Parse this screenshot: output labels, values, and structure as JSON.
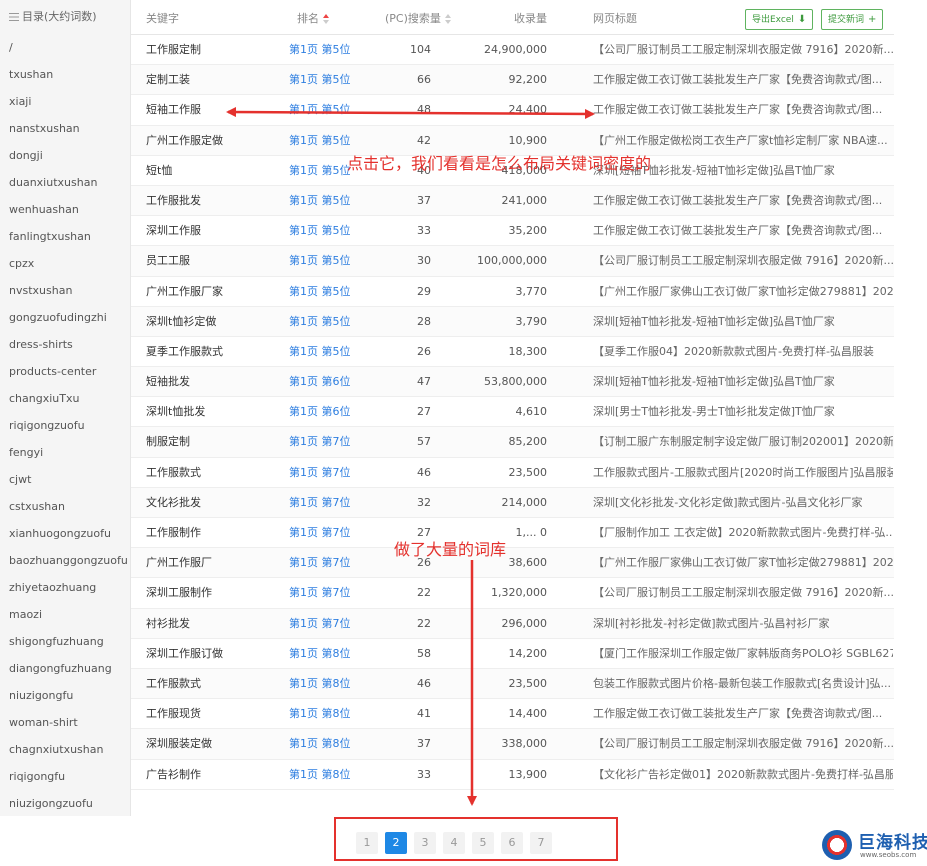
{
  "sidebar": {
    "title": "目录(大约词数)",
    "items": [
      "/",
      "txushan",
      "xiaji",
      "nanstxushan",
      "dongji",
      "duanxiutxushan",
      "wenhuashan",
      "fanlingtxushan",
      "cpzx",
      "nvstxushan",
      "gongzuofudingzhi",
      "dress-shirts",
      "products-center",
      "changxiuTxu",
      "riqigongzuofu",
      "fengyi",
      "cjwt",
      "cstxushan",
      "xianhuogongzuofu",
      "baozhuanggongzuofu",
      "zhiyetaozhuang",
      "maozi",
      "shigongfuzhuang",
      "diangongfuzhuang",
      "niuzigongfu",
      "woman-shirt",
      "chagnxiutxushan",
      "riqigongfu",
      "niuzigongzuofu"
    ]
  },
  "table": {
    "headers": {
      "keyword": "关键字",
      "rank": "排名",
      "pc": "(PC)搜索量",
      "included": "收录量",
      "title": "网页标题"
    },
    "export_label": "导出Excel",
    "submit_label": "提交新词",
    "rows": [
      {
        "keyword": "工作服定制",
        "rank": "第1页 第5位",
        "pc": "104",
        "included": "24,900,000",
        "title": "【公司厂服订制员工工服定制深圳衣服定做 7916】2020新..."
      },
      {
        "keyword": "定制工装",
        "rank": "第1页 第5位",
        "pc": "66",
        "included": "92,200",
        "title": "工作服定做工衣订做工装批发生产厂家【免费咨询款式/图..."
      },
      {
        "keyword": "短袖工作服",
        "rank": "第1页 第5位",
        "pc": "48",
        "included": "24,400",
        "title": "工作服定做工衣订做工装批发生产厂家【免费咨询款式/图..."
      },
      {
        "keyword": "广州工作服定做",
        "rank": "第1页 第5位",
        "pc": "42",
        "included": "10,900",
        "title": "【广州工作服定做松岗工衣生产厂家t恤衫定制厂家 NBA速..."
      },
      {
        "keyword": "短t恤",
        "rank": "第1页 第5位",
        "pc": "40",
        "included": "418,000",
        "title": "深圳[短袖T恤衫批发-短袖T恤衫定做]弘昌T恤厂家"
      },
      {
        "keyword": "工作服批发",
        "rank": "第1页 第5位",
        "pc": "37",
        "included": "241,000",
        "title": "工作服定做工衣订做工装批发生产厂家【免费咨询款式/图..."
      },
      {
        "keyword": "深圳工作服",
        "rank": "第1页 第5位",
        "pc": "33",
        "included": "35,200",
        "title": "工作服定做工衣订做工装批发生产厂家【免费咨询款式/图..."
      },
      {
        "keyword": "员工工服",
        "rank": "第1页 第5位",
        "pc": "30",
        "included": "100,000,000",
        "title": "【公司厂服订制员工工服定制深圳衣服定做 7916】2020新..."
      },
      {
        "keyword": "广州工作服厂家",
        "rank": "第1页 第5位",
        "pc": "29",
        "included": "3,770",
        "title": "【广州工作服厂家佛山工衣订做厂家T恤衫定做279881】202..."
      },
      {
        "keyword": "深圳t恤衫定做",
        "rank": "第1页 第5位",
        "pc": "28",
        "included": "3,790",
        "title": "深圳[短袖T恤衫批发-短袖T恤衫定做]弘昌T恤厂家"
      },
      {
        "keyword": "夏季工作服款式",
        "rank": "第1页 第5位",
        "pc": "26",
        "included": "18,300",
        "title": "【夏季工作服04】2020新款款式图片-免费打样-弘昌服装"
      },
      {
        "keyword": "短袖批发",
        "rank": "第1页 第6位",
        "pc": "47",
        "included": "53,800,000",
        "title": "深圳[短袖T恤衫批发-短袖T恤衫定做]弘昌T恤厂家"
      },
      {
        "keyword": "深圳t恤批发",
        "rank": "第1页 第6位",
        "pc": "27",
        "included": "4,610",
        "title": "深圳[男士T恤衫批发-男士T恤衫批发定做]T恤厂家"
      },
      {
        "keyword": "制服定制",
        "rank": "第1页 第7位",
        "pc": "57",
        "included": "85,200",
        "title": "【订制工服广东制服定制字设定做厂服订制202001】2020新..."
      },
      {
        "keyword": "工作服款式",
        "rank": "第1页 第7位",
        "pc": "46",
        "included": "23,500",
        "title": "工作服款式图片-工服款式图片[2020时尚工作服图片]弘昌服装"
      },
      {
        "keyword": "文化衫批发",
        "rank": "第1页 第7位",
        "pc": "32",
        "included": "214,000",
        "title": "深圳[文化衫批发-文化衫定做]款式图片-弘昌文化衫厂家"
      },
      {
        "keyword": "工作服制作",
        "rank": "第1页 第7位",
        "pc": "27",
        "included": "1,... 0",
        "title": "【厂服制作加工 工衣定做】2020新款款式图片-免费打样-弘..."
      },
      {
        "keyword": "广州工作服厂",
        "rank": "第1页 第7位",
        "pc": "26",
        "included": "38,600",
        "title": "【广州工作服厂家佛山工衣订做厂家T恤衫定做279881】202..."
      },
      {
        "keyword": "深圳工服制作",
        "rank": "第1页 第7位",
        "pc": "22",
        "included": "1,320,000",
        "title": "【公司厂服订制员工工服定制深圳衣服定做 7916】2020新..."
      },
      {
        "keyword": "衬衫批发",
        "rank": "第1页 第7位",
        "pc": "22",
        "included": "296,000",
        "title": "深圳[衬衫批发-衬衫定做]款式图片-弘昌衬衫厂家"
      },
      {
        "keyword": "深圳工作服订做",
        "rank": "第1页 第8位",
        "pc": "58",
        "included": "14,200",
        "title": "【厦门工作服深圳工作服定做厂家韩版商务POLO衫 SGBL627..."
      },
      {
        "keyword": "工作服款式",
        "rank": "第1页 第8位",
        "pc": "46",
        "included": "23,500",
        "title": "包装工作服款式图片价格-最新包装工作服款式[名贵设计]弘..."
      },
      {
        "keyword": "工作服现货",
        "rank": "第1页 第8位",
        "pc": "41",
        "included": "14,400",
        "title": "工作服定做工衣订做工装批发生产厂家【免费咨询款式/图..."
      },
      {
        "keyword": "深圳服装定做",
        "rank": "第1页 第8位",
        "pc": "37",
        "included": "338,000",
        "title": "【公司厂服订制员工工服定制深圳衣服定做 7916】2020新..."
      },
      {
        "keyword": "广告衫制作",
        "rank": "第1页 第8位",
        "pc": "33",
        "included": "13,900",
        "title": "【文化衫广告衫定做01】2020新款款式图片-免费打样-弘昌服装"
      }
    ]
  },
  "pagination": {
    "pages": [
      "1",
      "2",
      "3",
      "4",
      "5",
      "6",
      "7"
    ],
    "active": 2
  },
  "annotations": {
    "note1": "点击它，我们看看是怎么布局关键词密度的",
    "note2": "做了大量的词库"
  },
  "colors": {
    "annotation_red": "#e4312d",
    "link_blue": "#2d7ee0",
    "button_green": "#3c9a3c",
    "active_page": "#1e88e5"
  },
  "logo": {
    "name": "巨海科技",
    "site": "www.seobs.com"
  }
}
